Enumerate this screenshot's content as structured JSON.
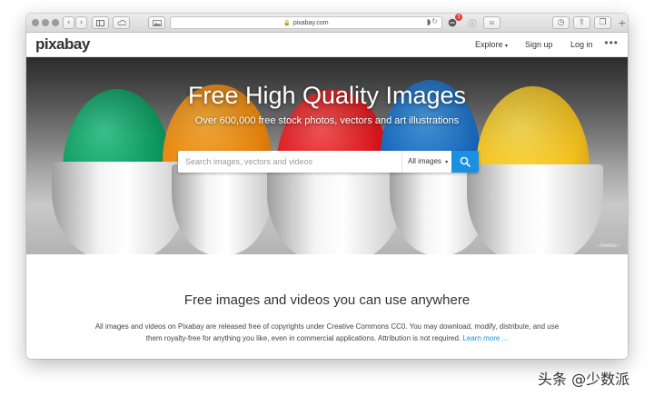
{
  "browser": {
    "address": "pixabay.com",
    "notification_badge": "3",
    "icons": [
      "back-icon",
      "forward-icon",
      "sidebar-icon",
      "icloud-icon",
      "photo-icon",
      "lock-icon",
      "reload-icon",
      "shield-icon",
      "extension-icon",
      "info-icon",
      "reader-icon",
      "history-icon",
      "share-icon",
      "tabs-icon",
      "new-tab-icon"
    ]
  },
  "site": {
    "logo": "pixabay",
    "nav": {
      "explore": "Explore",
      "signup": "Sign up",
      "login": "Log in",
      "more": "•••"
    }
  },
  "hero": {
    "title": "Free High Quality Images",
    "subtitle": "Over 600,000 free stock photos, vectors and art illustrations",
    "search_placeholder": "Search images, vectors and videos",
    "filter_label": "All images",
    "credit": "Anelka",
    "accent_color": "#1c90e0"
  },
  "content": {
    "title": "Free images and videos you can use anywhere",
    "text": "All images and videos on Pixabay are released free of copyrights under Creative Commons CC0. You may download, modify, distribute, and use them royalty-free for anything you like, even in commercial applications. Attribution is not required.",
    "link": "Learn more ..."
  },
  "watermark": "头条 @少数派"
}
